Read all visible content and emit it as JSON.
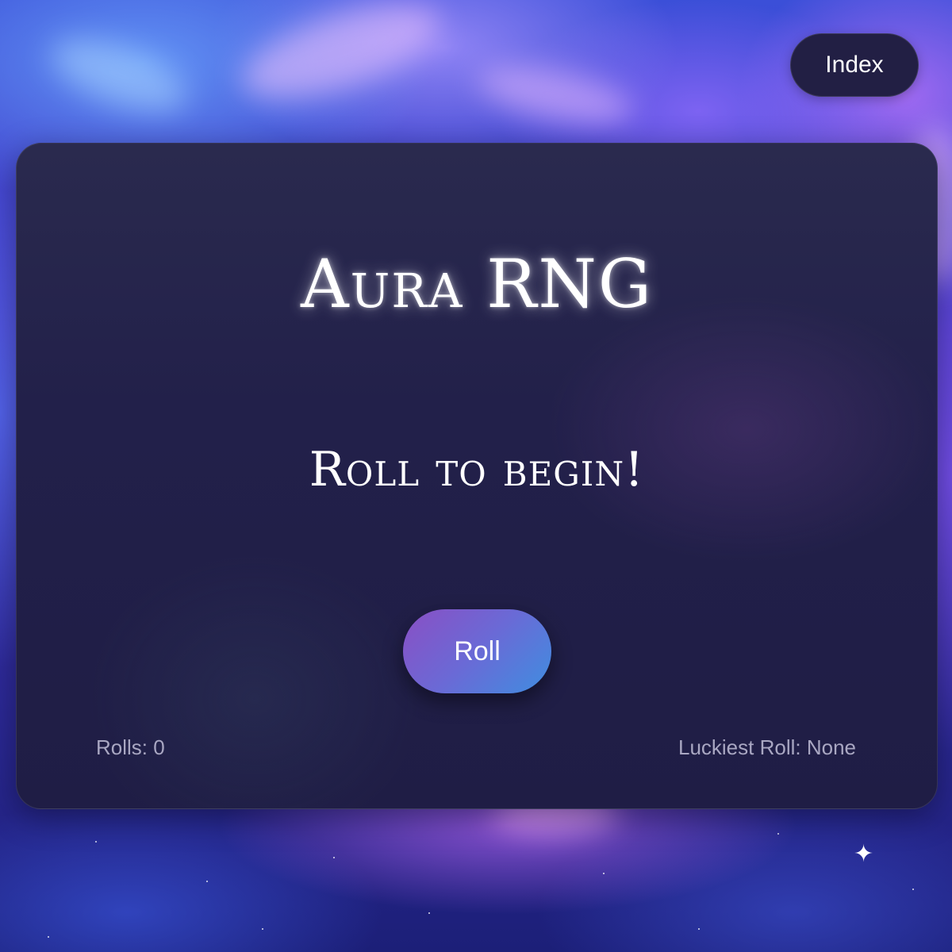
{
  "header": {
    "index_label": "Index"
  },
  "game": {
    "title": "Aura RNG",
    "status": "Roll to begin!",
    "roll_label": "Roll",
    "rolls_label": "Rolls:",
    "rolls_value": "0",
    "luckiest_label": "Luckiest Roll:",
    "luckiest_value": "None"
  },
  "colors": {
    "card_bg": "#22204a",
    "button_gradient_start": "#8a4fc4",
    "button_gradient_end": "#3f8ee0",
    "index_button_bg": "#221f44",
    "stat_text": "#a9a7c2"
  }
}
